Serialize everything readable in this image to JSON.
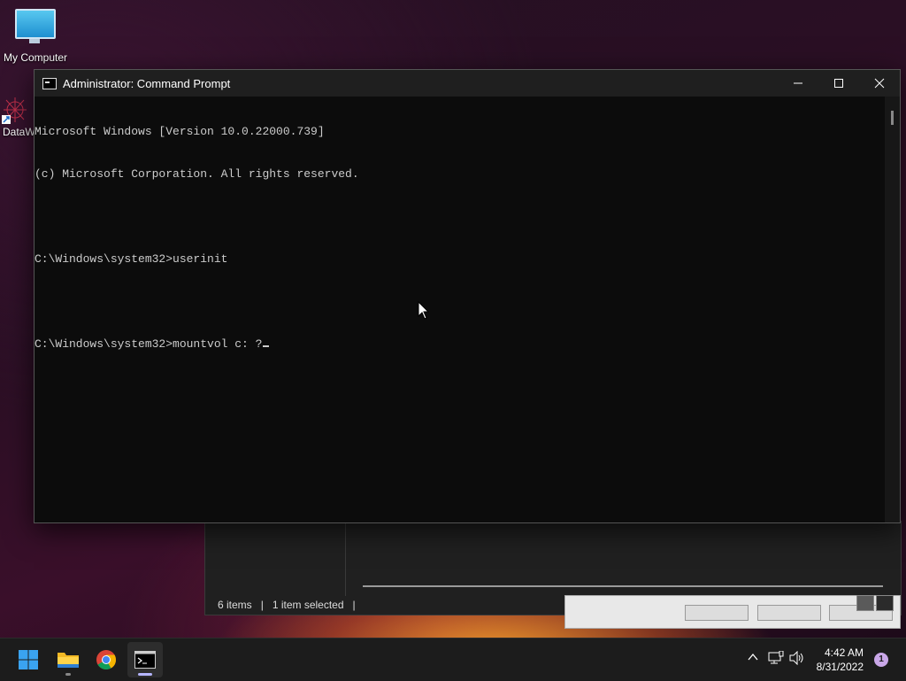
{
  "desktop": {
    "icons": [
      {
        "label": "My Computer"
      },
      {
        "label": "DataW"
      }
    ]
  },
  "explorer": {
    "status_items": "6 items",
    "status_selected": "1 item selected"
  },
  "cmd_window": {
    "title": "Administrator: Command Prompt",
    "lines": [
      "Microsoft Windows [Version 10.0.22000.739]",
      "(c) Microsoft Corporation. All rights reserved.",
      "",
      "C:\\Windows\\system32>userinit",
      "",
      "C:\\Windows\\system32>mountvol c: ?"
    ]
  },
  "taskbar": {
    "apps": [
      {
        "name": "start-icon"
      },
      {
        "name": "file-explorer-icon"
      },
      {
        "name": "chrome-icon"
      },
      {
        "name": "command-prompt-icon",
        "active": true
      }
    ],
    "tray": {
      "time": "4:42 AM",
      "date": "8/31/2022",
      "notification_count": "1"
    }
  }
}
